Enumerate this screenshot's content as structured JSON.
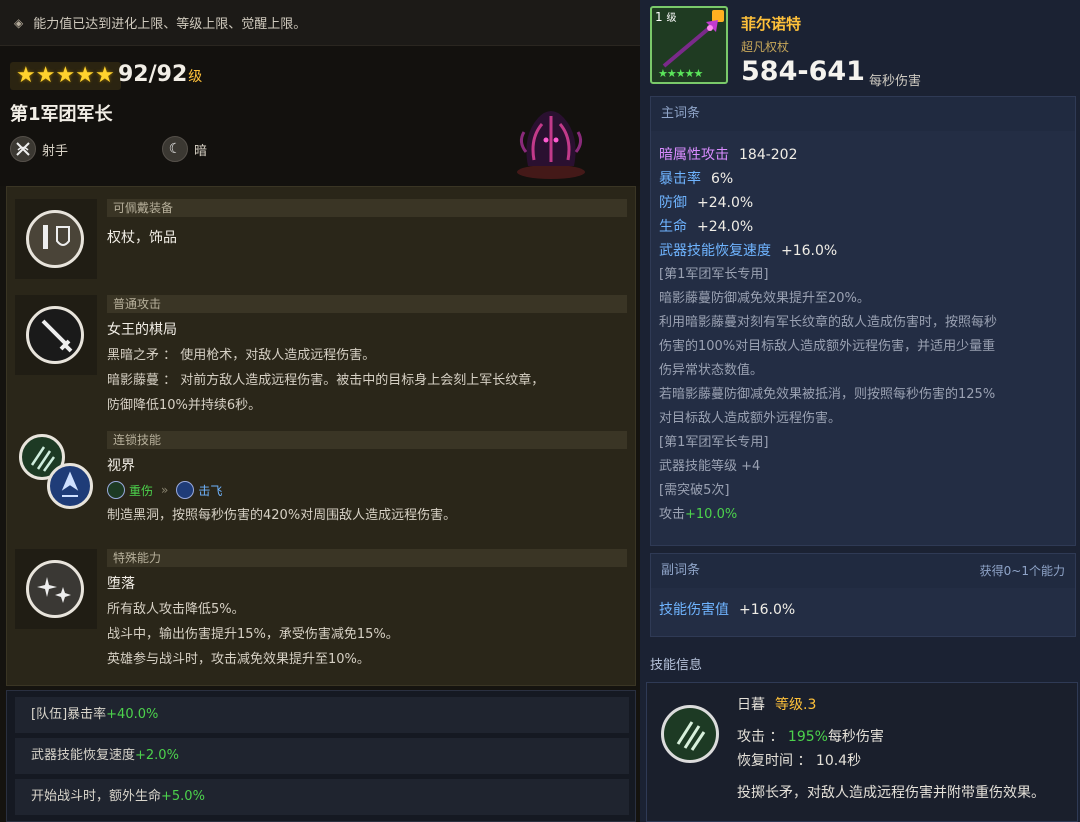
{
  "notice": {
    "text": "能力值已达到进化上限、等级上限、觉醒上限。"
  },
  "hero": {
    "stars": 5,
    "level": "92/92",
    "level_unit": "级",
    "name": "第1军团军长",
    "class_label": "射手",
    "element_label": "暗"
  },
  "abilities": [
    {
      "header": "可佩戴装备",
      "lines": [
        "权杖，饰品"
      ]
    },
    {
      "header": "普通攻击",
      "title": "女王的棋局",
      "lines": [
        "黑暗之矛 ： 使用枪术，对敌人造成远程伤害。",
        "暗影藤蔓 ： 对前方敌人造成远程伤害。被击中的目标身上会刻上军长纹章，",
        "防御降低10%并持续6秒。"
      ]
    },
    {
      "header": "连锁技能",
      "title": "视界",
      "chain_from": "重伤",
      "chain_to": "击飞",
      "lines": [
        "制造黑洞，按照每秒伤害的420%对周围敌人造成远程伤害。"
      ]
    },
    {
      "header": "特殊能力",
      "title": "堕落",
      "lines": [
        "所有敌人攻击降低5%。",
        "战斗中，输出伤害提升15%，承受伤害减免15%。",
        "英雄参与战斗时，攻击减免效果提升至10%。"
      ]
    }
  ],
  "bonuses": [
    {
      "label": "[队伍]暴击率",
      "value": "+40.0%"
    },
    {
      "label": "武器技能恢复速度",
      "value": "+2.0%"
    },
    {
      "label": "开始战斗时，额外生命",
      "value": "+5.0%"
    }
  ],
  "weapon": {
    "level_num": "1",
    "level_unit": "级",
    "stars": "★★★★★",
    "name": "菲尔诺特",
    "type": "超凡权杖",
    "dps": "584-641",
    "dps_unit": "每秒伤害"
  },
  "main_stats": {
    "header": "主词条",
    "stats": [
      {
        "key": "暗属性攻击",
        "value": "184-202"
      },
      {
        "key": "暴击率",
        "value": "6%"
      },
      {
        "key": "防御",
        "value": "+24.0%"
      },
      {
        "key": "生命",
        "value": "+24.0%"
      },
      {
        "key": "武器技能恢复速度",
        "value": "+16.0%"
      }
    ],
    "desc": [
      "[第1军团军长专用]",
      "暗影藤蔓防御减免效果提升至20%。",
      "利用暗影藤蔓对刻有军长纹章的敌人造成伤害时，按照每秒",
      "伤害的100%对目标敌人造成额外远程伤害，并适用少量重",
      "伤异常状态数值。",
      "若暗影藤蔓防御减免效果被抵消，则按照每秒伤害的125%",
      "对目标敌人造成额外远程伤害。",
      "[第1军团军长专用]",
      "武器技能等级  +4",
      "[需突破5次]"
    ],
    "final_key": "攻击",
    "final_value": "+10.0%"
  },
  "sub_stats": {
    "header": "副词条",
    "note": "获得0~1个能力",
    "key": "技能伤害值",
    "value": "+16.0%"
  },
  "skill": {
    "section_title": "技能信息",
    "name": "日暮",
    "level": "等级.3",
    "atk_label": "攻击 ：",
    "atk_pct": "195%",
    "atk_unit": "每秒伤害",
    "cd_label": "恢复时间 ：",
    "cd_value": "10.4秒",
    "desc": "投掷长矛，对敌人造成远程伤害并附带重伤效果。"
  },
  "colors": {
    "gold": "#ffc13a",
    "green": "#4cd24c",
    "purple": "#d98cff",
    "blue": "#6fb4ff"
  }
}
